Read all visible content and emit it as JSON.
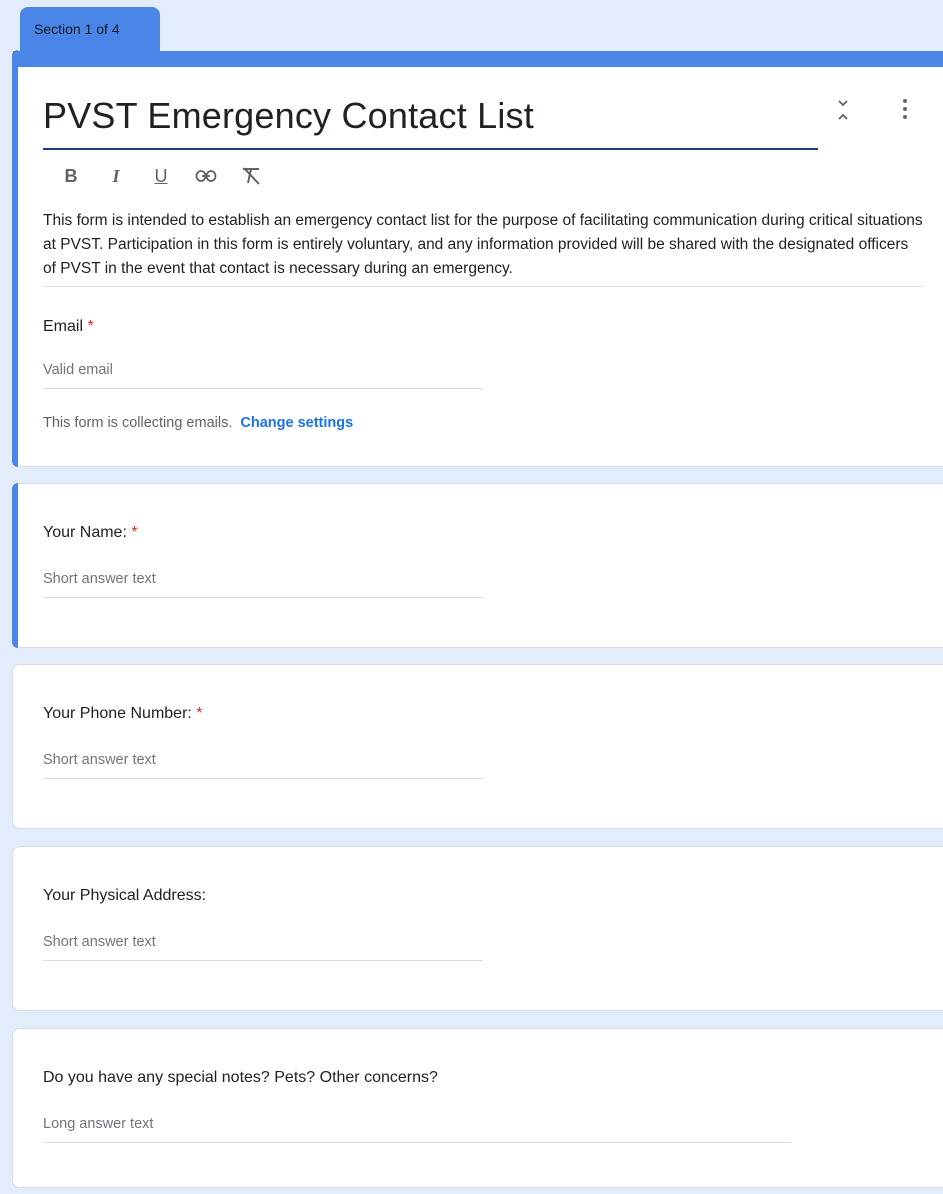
{
  "section_tab": {
    "label": "Section 1 of 4"
  },
  "header_card": {
    "title": "PVST Emergency Contact List",
    "toolbar": [
      "B",
      "I",
      "U",
      "link-icon",
      "clear-format-icon"
    ],
    "description": "This form is intended to establish an emergency contact list for the purpose of facilitating communication during critical situations at PVST. Participation in this form is entirely voluntary, and any information provided will be shared with the designated officers of PVST in the event that contact is necessary during an emergency.",
    "email_label": "Email",
    "required_mark": "*",
    "email_placeholder": "Valid email",
    "collecting_text": "This form is collecting emails.",
    "change_settings": "Change settings"
  },
  "questions": [
    {
      "label": "Your Name:",
      "required": true,
      "answer_placeholder": "Short answer text"
    },
    {
      "label": "Your Phone Number:",
      "required": true,
      "answer_placeholder": "Short answer text"
    },
    {
      "label": "Your Physical Address:",
      "required": false,
      "answer_placeholder": "Short answer text"
    },
    {
      "label": "Do you have any special notes? Pets? Other concerns?",
      "required": false,
      "answer_placeholder": "Long answer text"
    }
  ],
  "colors": {
    "accent": "#4a86e8",
    "required": "#d93025",
    "link": "#1a73e8",
    "background": "#e3ecfa"
  }
}
